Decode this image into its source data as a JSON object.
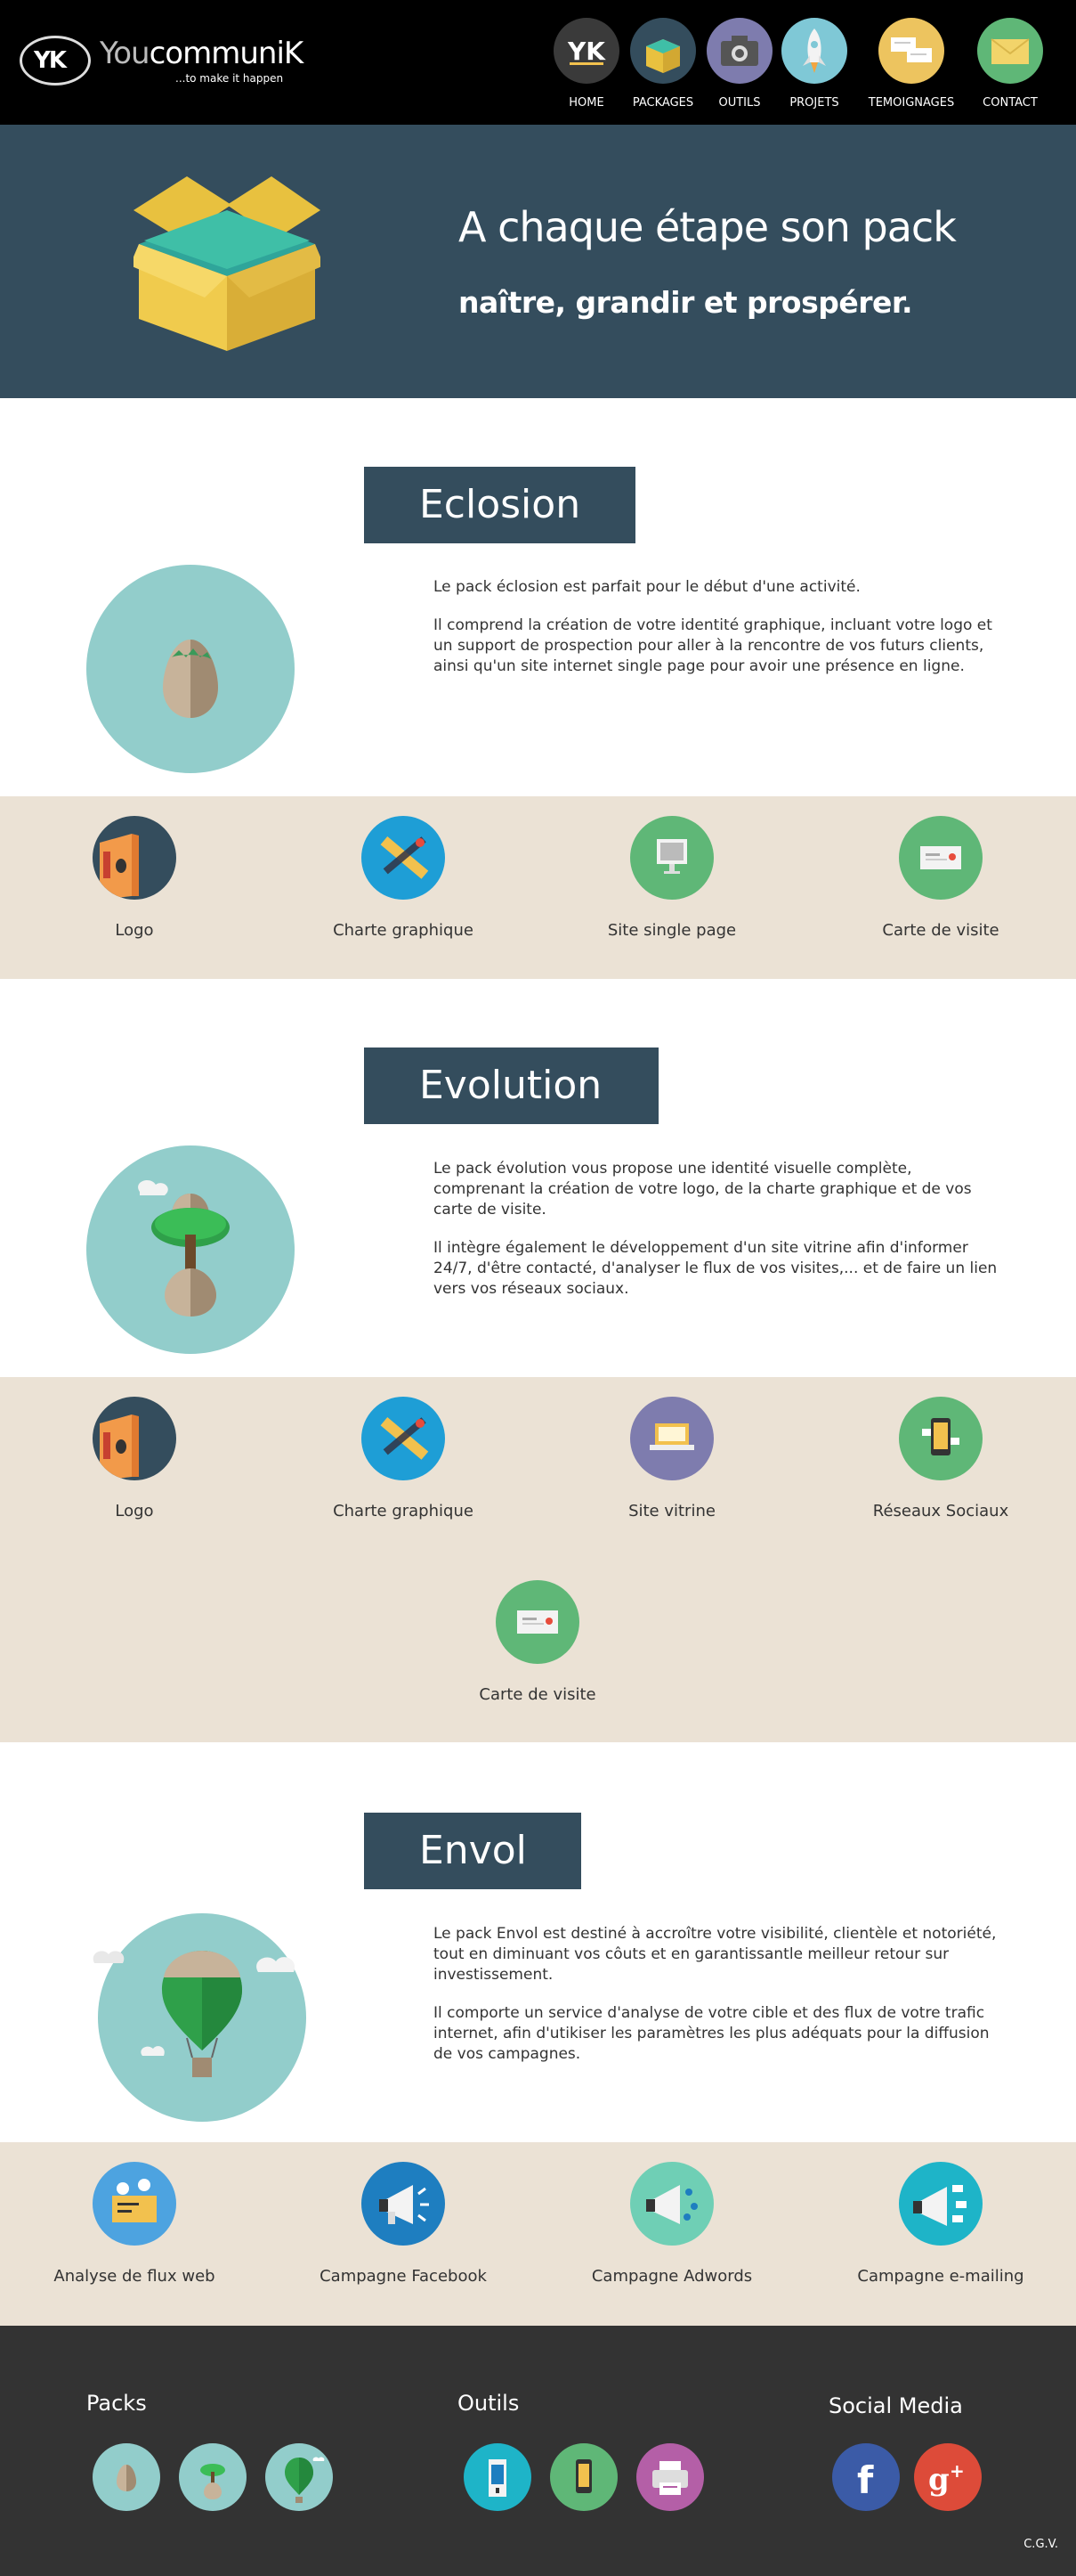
{
  "header": {
    "logo_mark": "YK",
    "brand_prefix": "You",
    "brand_suffix": "communiK",
    "tagline": "...to make it happen",
    "nav": [
      {
        "label": "HOME",
        "icon": "yk-logo-icon",
        "color": "#333333"
      },
      {
        "label": "PACKAGES",
        "icon": "box-icon",
        "color": "#344d5d"
      },
      {
        "label": "OUTILS",
        "icon": "camera-icon",
        "color": "#7e7cae"
      },
      {
        "label": "PROJETS",
        "icon": "rocket-icon",
        "color": "#7fc8d6"
      },
      {
        "label": "TEMOIGNAGES",
        "icon": "speech-bubbles-icon",
        "color": "#edc45f"
      },
      {
        "label": "CONTACT",
        "icon": "envelope-icon",
        "color": "#5fb777"
      }
    ]
  },
  "hero": {
    "title": "A chaque étape son pack",
    "subtitle": "naître, grandir et prospérer.",
    "icon": "open-box-icon"
  },
  "packs": [
    {
      "title": "Eclosion",
      "icon": "egg-icon",
      "paragraphs": [
        "Le pack éclosion est parfait pour le début d'une activité.",
        "Il comprend la création de votre identité graphique, incluant votre logo et un support de prospection pour aller à la rencontre de vos futurs clients, ainsi qu'un site internet single page pour avoir une présence en ligne."
      ],
      "features": [
        {
          "label": "Logo",
          "icon": "logo-book-icon"
        },
        {
          "label": "Charte graphique",
          "icon": "pencil-ruler-icon"
        },
        {
          "label": "Site single page",
          "icon": "monitor-icon"
        },
        {
          "label": "Carte de visite",
          "icon": "business-card-icon"
        }
      ]
    },
    {
      "title": "Evolution",
      "icon": "sprout-tree-icon",
      "paragraphs": [
        "Le pack évolution vous propose une identité visuelle complète, comprenant la création de votre logo, de la charte graphique et de vos carte de visite.",
        "Il intègre également le développement d'un site vitrine afin d'informer 24/7, d'être contacté, d'analyser le flux de vos visites,... et de faire un lien vers vos réseaux sociaux."
      ],
      "features": [
        {
          "label": "Logo",
          "icon": "logo-book-icon"
        },
        {
          "label": "Charte graphique",
          "icon": "pencil-ruler-icon"
        },
        {
          "label": "Site vitrine",
          "icon": "laptop-icon"
        },
        {
          "label": "Réseaux Sociaux",
          "icon": "smartphone-social-icon"
        },
        {
          "label": "Carte de visite",
          "icon": "business-card-icon"
        }
      ]
    },
    {
      "title": "Envol",
      "icon": "hot-air-balloon-icon",
      "paragraphs": [
        "Le pack Envol est destiné à accroître votre visibilité, clientèle et notoriété, tout en diminuant vos côuts et en garantissantle meilleur retour sur investissement.",
        "Il comporte un service d'analyse de votre cible et des flux de votre trafic internet, afin d'utikiser les paramètres les plus adéquats pour la diffusion de vos campagnes."
      ],
      "features": [
        {
          "label": "Analyse de flux web",
          "icon": "analytics-board-icon"
        },
        {
          "label": "Campagne Facebook",
          "icon": "megaphone-facebook-icon"
        },
        {
          "label": "Campagne Adwords",
          "icon": "megaphone-adwords-icon"
        },
        {
          "label": "Campagne e-mailing",
          "icon": "megaphone-email-icon"
        }
      ]
    }
  ],
  "footer": {
    "packs_title": "Packs",
    "tools_title": "Outils",
    "social_title": "Social Media",
    "packs_icons": [
      "egg-icon",
      "sprout-tree-icon",
      "hot-air-balloon-icon"
    ],
    "tools_icons": [
      "phone-booth-icon",
      "smartphone-icon",
      "printer-icon"
    ],
    "social_icons": [
      "facebook-icon",
      "google-plus-icon"
    ],
    "cgv": "C.G.V."
  }
}
